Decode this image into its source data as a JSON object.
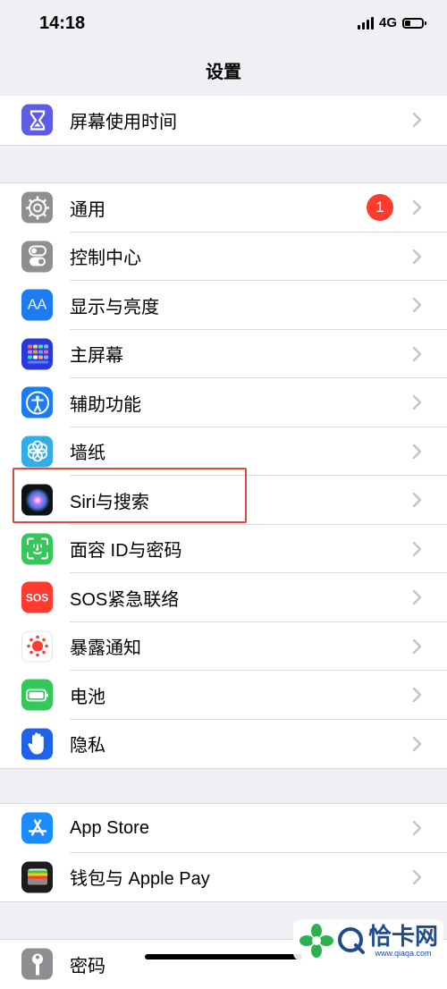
{
  "status_bar": {
    "time": "14:18",
    "network": "4G"
  },
  "nav": {
    "title": "设置"
  },
  "group1": [
    {
      "label": "屏幕使用时间",
      "icon": "hourglass-icon"
    }
  ],
  "group2": [
    {
      "label": "通用",
      "icon": "gear-icon",
      "badge": "1"
    },
    {
      "label": "控制中心",
      "icon": "toggles-icon"
    },
    {
      "label": "显示与亮度",
      "icon": "text-size-icon"
    },
    {
      "label": "主屏幕",
      "icon": "app-grid-icon"
    },
    {
      "label": "辅助功能",
      "icon": "accessibility-icon"
    },
    {
      "label": "墙纸",
      "icon": "flower-icon"
    },
    {
      "label": "Siri与搜索",
      "icon": "siri-icon"
    },
    {
      "label": "面容 ID与密码",
      "icon": "face-id-icon"
    },
    {
      "label": "SOS紧急联络",
      "icon": "sos-icon"
    },
    {
      "label": "暴露通知",
      "icon": "exposure-icon"
    },
    {
      "label": "电池",
      "icon": "battery-icon"
    },
    {
      "label": "隐私",
      "icon": "hand-icon"
    }
  ],
  "group3": [
    {
      "label": "App Store",
      "icon": "app-store-icon"
    },
    {
      "label": "钱包与 Apple Pay",
      "icon": "wallet-icon"
    }
  ],
  "group4": [
    {
      "label": "密码",
      "icon": "key-icon"
    }
  ],
  "icon_glyphs": {
    "sos": "SOS",
    "text_size": "AA"
  },
  "watermark": {
    "brand": "恰卡网",
    "url": "www.qiaqa.com"
  },
  "colors": {
    "accent_red": "#ff3b30",
    "highlight_border": "#d94a3a",
    "background": "#efeff4"
  }
}
